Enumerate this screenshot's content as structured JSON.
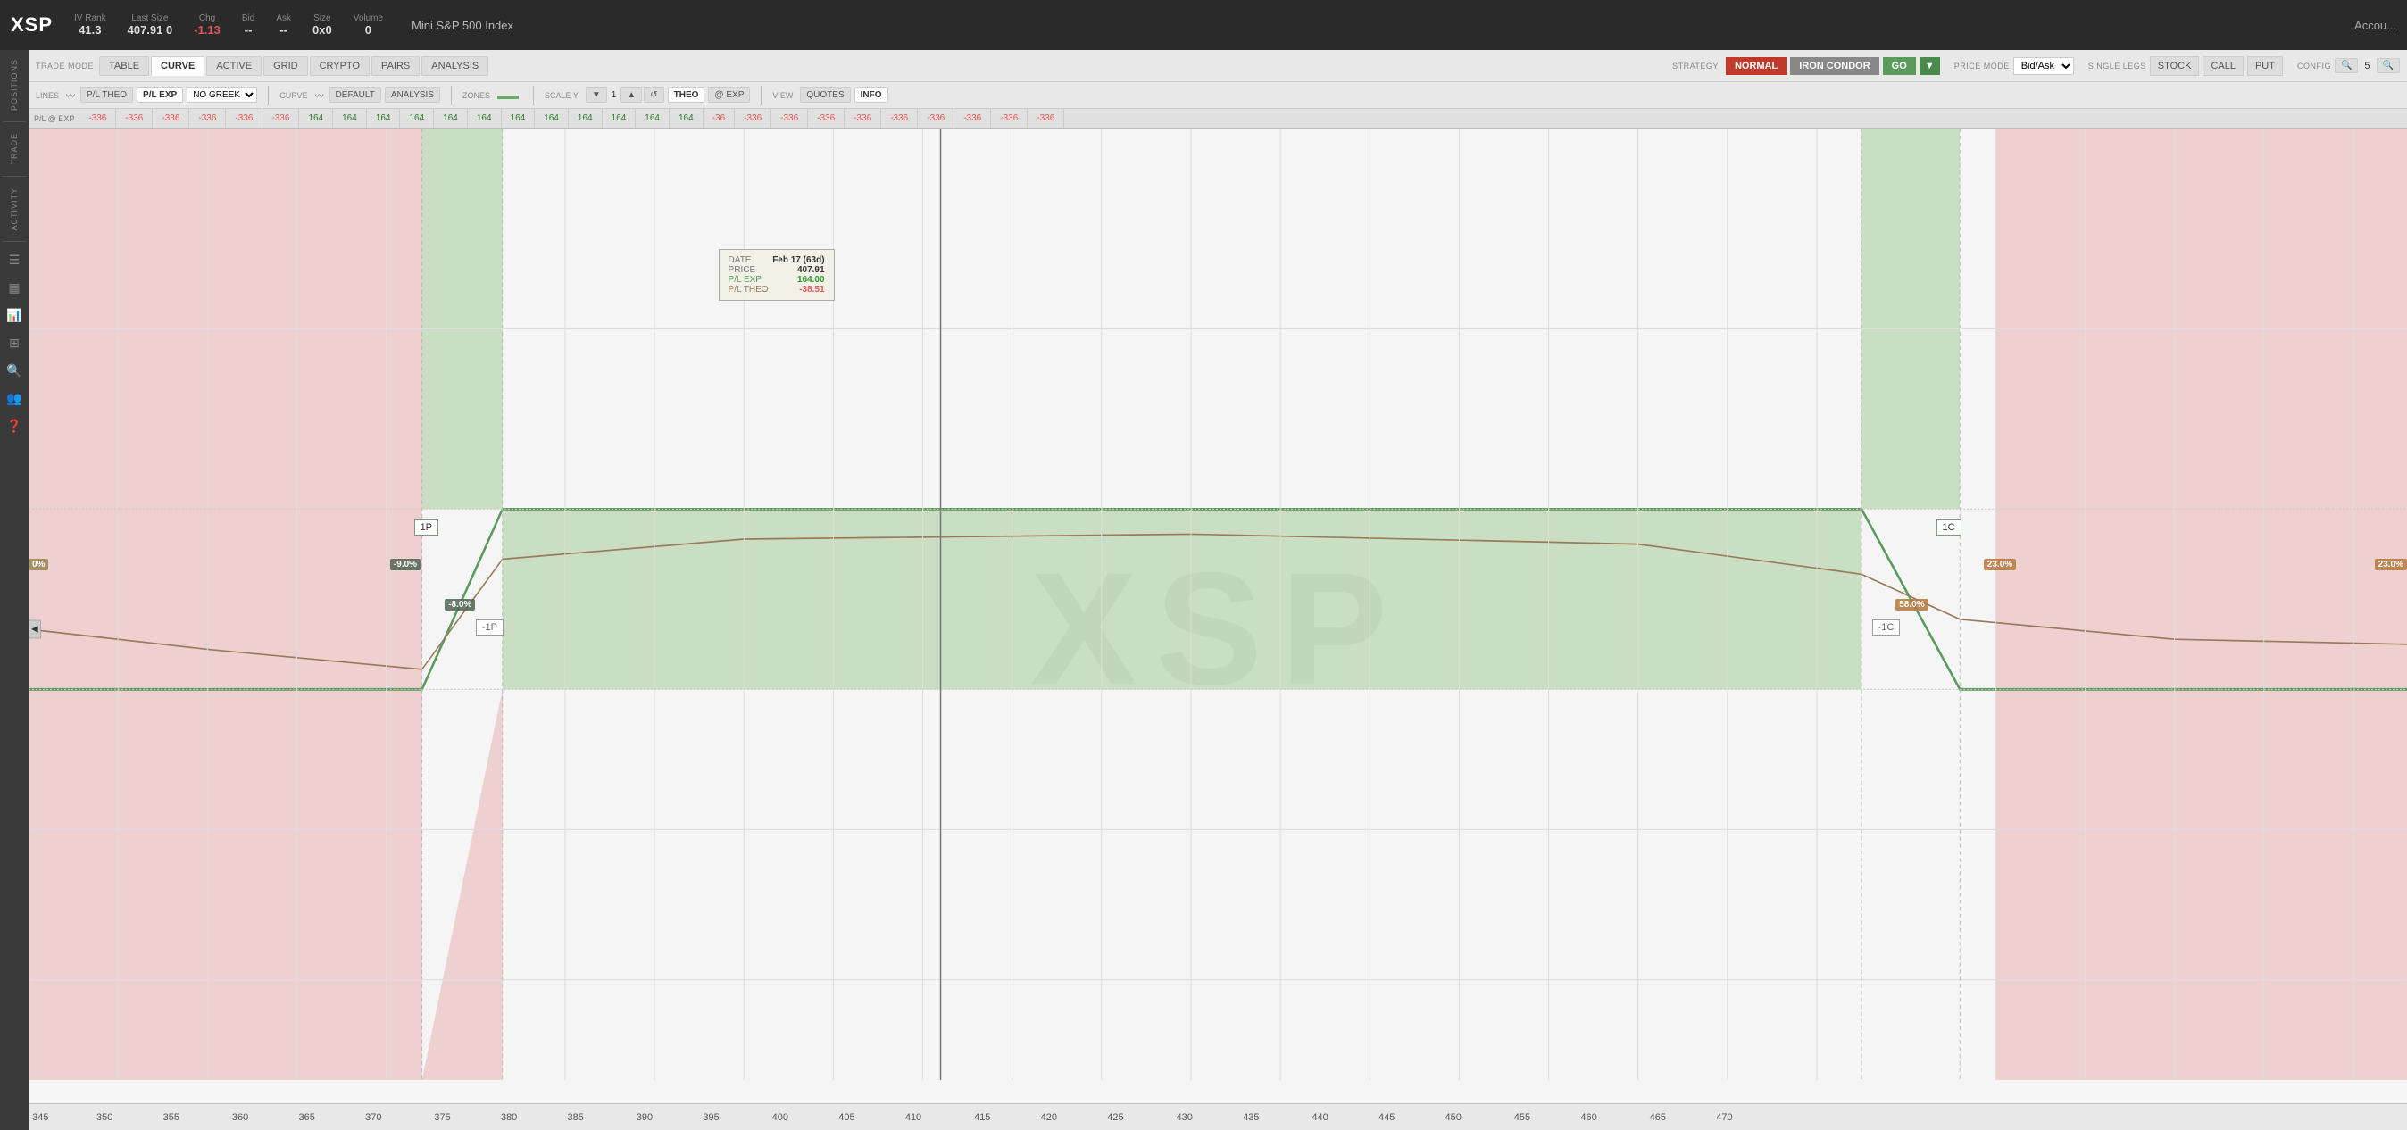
{
  "app": {
    "title": "XSP",
    "instrument": "Mini S&P 500 Index",
    "watermark": "XSP"
  },
  "header": {
    "iv_rank_label": "IV Rank",
    "iv_rank_value": "41.3",
    "last_size_label": "Last Size",
    "last_size_value": "407.91",
    "last_size_suffix": "0",
    "chg_label": "Chg",
    "chg_value": "-1.13",
    "bid_label": "Bid",
    "bid_value": "--",
    "ask_label": "Ask",
    "ask_value": "--",
    "size_label": "Size",
    "size_value": "0x0",
    "volume_label": "Volume",
    "volume_value": "0",
    "account_label": "Accou..."
  },
  "trade_mode": {
    "label": "TRADE MODE",
    "tabs": [
      "TABLE",
      "CURVE",
      "ACTIVE",
      "GRID",
      "CRYPTO",
      "PAIRS",
      "ANALYSIS"
    ]
  },
  "strategy": {
    "label": "STRATEGY",
    "normal_btn": "NORMAL",
    "iron_condor_btn": "IRON CONDOR",
    "go_btn": "GO"
  },
  "price_mode": {
    "label": "PRICE MODE",
    "value": "Bid/Ask"
  },
  "single_legs": {
    "label": "SINGLE LEGS",
    "stock_btn": "STOCK",
    "call_btn": "CALL",
    "put_btn": "PUT"
  },
  "config": {
    "label": "CONFIG",
    "zoom_value": "5"
  },
  "lines": {
    "label": "LINES",
    "pl_theo_btn": "P/L THEO",
    "pl_exp_btn": "P/L EXP",
    "no_greek_label": "NO GREEK"
  },
  "curve": {
    "label": "CURVE",
    "default_btn": "DEFAULT",
    "analysis_btn": "ANALYSIS"
  },
  "zones": {
    "label": "ZONES"
  },
  "scale_y": {
    "label": "SCALE Y",
    "theo_btn": "THEO",
    "at_exp_btn": "@ EXP",
    "value": "1"
  },
  "view": {
    "label": "VIEW",
    "quotes_btn": "QUOTES",
    "info_btn": "INFO"
  },
  "pl_row": {
    "label": "P/L @ EXP",
    "values_neg": [
      "-336",
      "-336",
      "-336",
      "-336",
      "-336",
      "-336"
    ],
    "values_pos": [
      "164",
      "164",
      "164",
      "164",
      "164",
      "164"
    ],
    "values_neg2": [
      "-36",
      "-336",
      "-336",
      "-336",
      "-336",
      "-336",
      "-336"
    ],
    "value_last_neg": "-336"
  },
  "tooltip": {
    "date_label": "DATE",
    "date_value": "Feb 17 (63d)",
    "price_label": "PRICE",
    "price_value": "407.91",
    "pl_exp_label": "P/L EXP",
    "pl_exp_value": "164.00",
    "pl_theo_label": "P/L THEO",
    "pl_theo_value": "-38.51"
  },
  "strike_labels": {
    "long_put": "1P",
    "long_call": "1C",
    "short_put": "-1P",
    "short_call": "-1C"
  },
  "percentages": {
    "left_neg": "-9.0%",
    "left_short_neg": "-8.0%",
    "right_pos": "23.0%",
    "right_short_pos": "58.0%",
    "far_right": "23.0%",
    "far_left": "0%"
  },
  "x_axis_labels": [
    "345",
    "350",
    "355",
    "360",
    "365",
    "370",
    "375",
    "380",
    "385",
    "390",
    "395",
    "400",
    "405",
    "410",
    "415",
    "420",
    "425",
    "430",
    "435",
    "440",
    "445",
    "450",
    "455",
    "460",
    "465",
    "470"
  ],
  "chart": {
    "price_line_x_pct": 38.5,
    "condor_left_loss_start_pct": 0,
    "condor_left_loss_end_pct": 23,
    "condor_profit_start_pct": 23,
    "condor_profit_end_pct": 72,
    "condor_right_loss_start_pct": 72,
    "condor_right_loss_end_pct": 100
  }
}
